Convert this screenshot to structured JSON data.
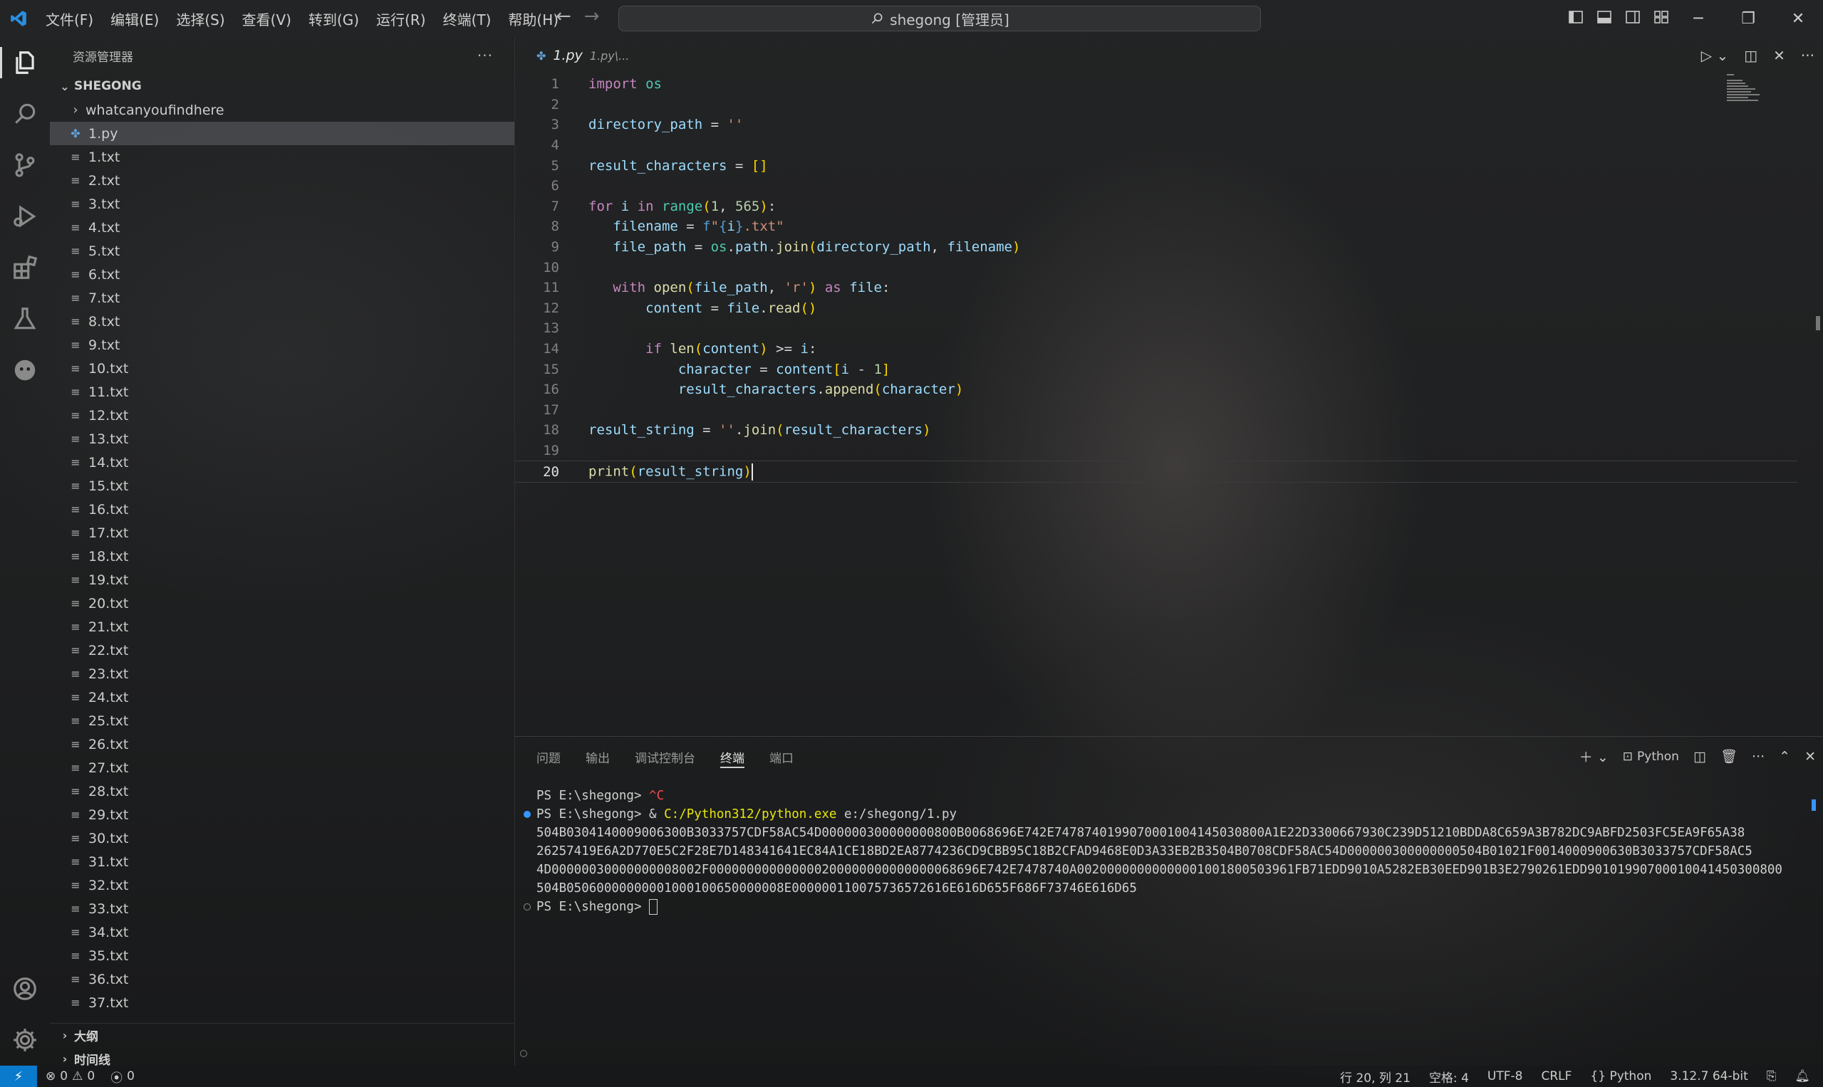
{
  "menu": [
    "文件(F)",
    "编辑(E)",
    "选择(S)",
    "查看(V)",
    "转到(G)",
    "运行(R)",
    "终端(T)",
    "帮助(H)"
  ],
  "search": {
    "text": "shegong [管理员]"
  },
  "window_buttons": {
    "minimize": "─",
    "restore": "❐",
    "close": "✕"
  },
  "sidebar": {
    "title": "资源管理器",
    "more": "···",
    "section": "SHEGONG",
    "folder": "whatcanyoufindhere",
    "selected_file": "1.py",
    "files": [
      "1.txt",
      "2.txt",
      "3.txt",
      "4.txt",
      "5.txt",
      "6.txt",
      "7.txt",
      "8.txt",
      "9.txt",
      "10.txt",
      "11.txt",
      "12.txt",
      "13.txt",
      "14.txt",
      "15.txt",
      "16.txt",
      "17.txt",
      "18.txt",
      "19.txt",
      "20.txt",
      "21.txt",
      "22.txt",
      "23.txt",
      "24.txt",
      "25.txt",
      "26.txt",
      "27.txt",
      "28.txt",
      "29.txt",
      "30.txt",
      "31.txt",
      "32.txt",
      "33.txt",
      "34.txt",
      "35.txt",
      "36.txt",
      "37.txt"
    ],
    "outline": "大纲",
    "timeline": "时间线"
  },
  "editor": {
    "tab_name": "1.py",
    "tab_desc": "1.py\\...",
    "line_numbers": [
      "1",
      "2",
      "3",
      "4",
      "5",
      "6",
      "7",
      "8",
      "9",
      "10",
      "11",
      "12",
      "13",
      "14",
      "15",
      "16",
      "17",
      "18",
      "19",
      "20"
    ],
    "current_line": 20
  },
  "panel": {
    "tabs": [
      "问题",
      "输出",
      "调试控制台",
      "终端",
      "端口"
    ],
    "active_tab": "终端",
    "profile": "Python",
    "lines": {
      "l1_prompt": "PS E:\\shegong> ",
      "l1_ctrl": "^C",
      "l2_prompt": "PS E:\\shegong> & ",
      "l2_exe": "C:/Python312/python.exe",
      "l2_arg": " e:/shegong/1.py",
      "out1": "504B0304140009006300B3033757CDF58AC54D000000300000000800B0068696E742E7478740199070001004145030800A1E22D3300667930C239D51210BDDA8C659A3B782DC9ABFD2503FC5EA9F65A38",
      "out2": "26257419E6A2D770E5C2F28E7D148341641EC84A1CE18BD2EA8774236CD9CBB95C18B2CFAD9468E0D3A33EB2B3504B0708CDF58AC54D000000300000000504B01021F0014000900630B3033757CDF58AC5",
      "out3": "4D00000030000000008002F000000000000000200000000000000068696E742E7478740A00200000000000001001800503961FB71EDD9010A5282EB30EED901B3E2790261EDD90101990700010041450300800",
      "out4": "504B05060000000001000100650000008E000000110075736572616E616D655F686F73746E616D65",
      "l3_prompt": "PS E:\\shegong> "
    }
  },
  "status": {
    "errors": "0",
    "warnings": "0",
    "ports": "0",
    "position": "行 20, 列 21",
    "spaces": "空格: 4",
    "encoding": "UTF-8",
    "eol": "CRLF",
    "language": "Python",
    "interpreter": "3.12.7 64-bit"
  }
}
